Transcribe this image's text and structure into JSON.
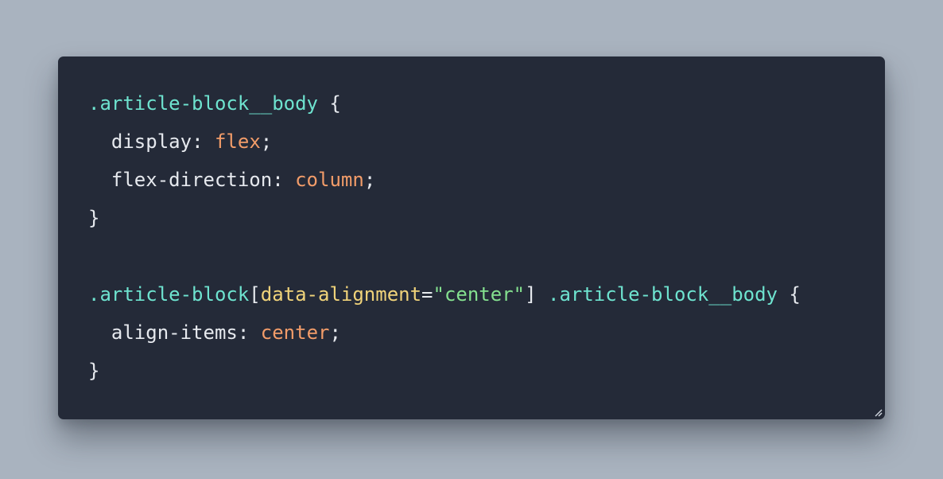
{
  "code": {
    "lines": [
      {
        "selector": ".article-block__body",
        "brace": " {"
      },
      {
        "indent": "  ",
        "property": "display",
        "colon": ": ",
        "value": "flex",
        "semi": ";"
      },
      {
        "indent": "  ",
        "property": "flex-direction",
        "colon": ": ",
        "value": "column",
        "semi": ";"
      },
      {
        "close": "}"
      },
      {},
      {
        "selector_a": ".article-block",
        "open_bracket": "[",
        "attribute": "data-alignment",
        "equals": "=",
        "string": "\"center\"",
        "close_bracket": "]",
        "space": " ",
        "selector_b": ".article-block__body",
        "brace": " {"
      },
      {
        "indent": "  ",
        "property": "align-items",
        "colon": ": ",
        "value": "center",
        "semi": ";"
      },
      {
        "close": "}"
      }
    ]
  },
  "colors": {
    "page_background": "#a9b3bf",
    "editor_background": "#242a38",
    "selector": "#6ee3cf",
    "attribute": "#f0d37a",
    "string": "#84e08f",
    "value": "#f29c69",
    "plain_text": "#e6e9ee"
  },
  "icons": {
    "resize_handle": "resize-handle-icon"
  }
}
